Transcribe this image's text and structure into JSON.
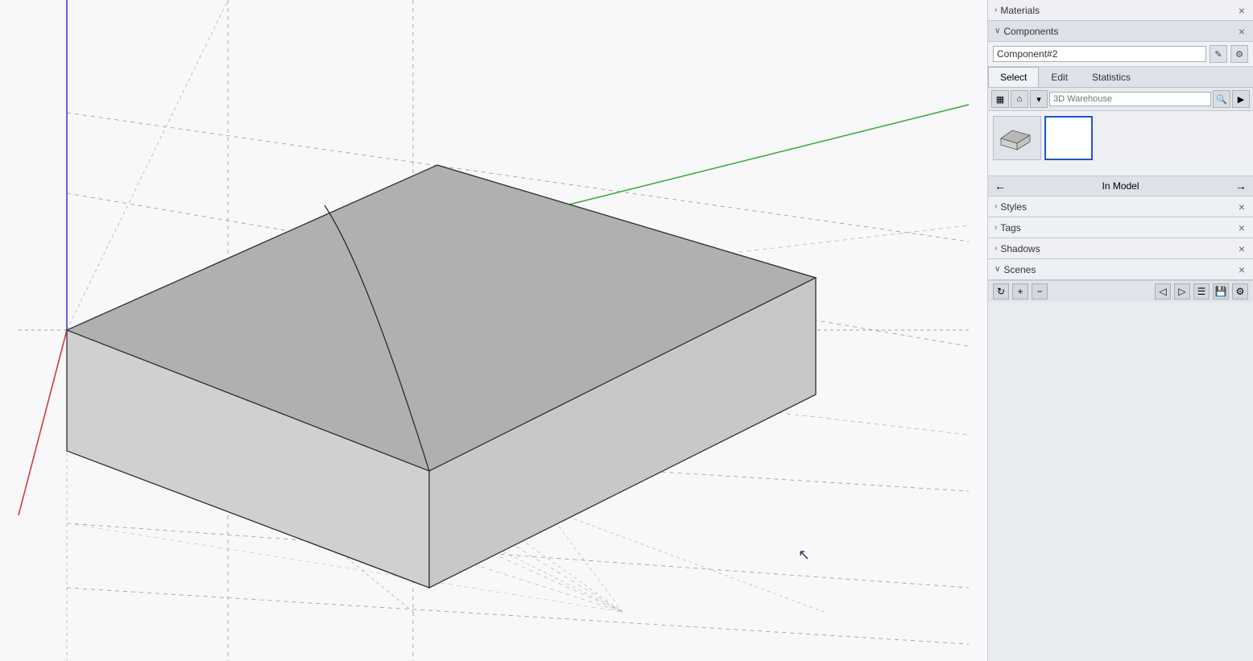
{
  "panels": {
    "materials": {
      "title": "Materials",
      "close": "×"
    },
    "components": {
      "title": "Components",
      "close": "×",
      "component_name": "Component#2",
      "tabs": [
        "Select",
        "Edit",
        "Statistics"
      ],
      "active_tab": "Select",
      "search_placeholder": "3D Warehouse",
      "in_model_label": "In Model"
    },
    "styles": {
      "title": "Styles",
      "close": "×"
    },
    "tags": {
      "title": "Tags",
      "close": "×"
    },
    "shadows": {
      "title": "Shadows",
      "close": "×"
    },
    "scenes": {
      "title": "Scenes",
      "close": "×"
    }
  },
  "toolbar": {
    "icons": {
      "home": "⌂",
      "search": "🔍",
      "arrow": "▶",
      "refresh": "↻",
      "plus": "+",
      "minus": "−",
      "grid": "▦",
      "nav_left": "◀",
      "nav_right": "▶",
      "details": "☰",
      "save": "💾",
      "settings": "⚙"
    }
  },
  "viewport": {
    "cursor_visible": true
  }
}
